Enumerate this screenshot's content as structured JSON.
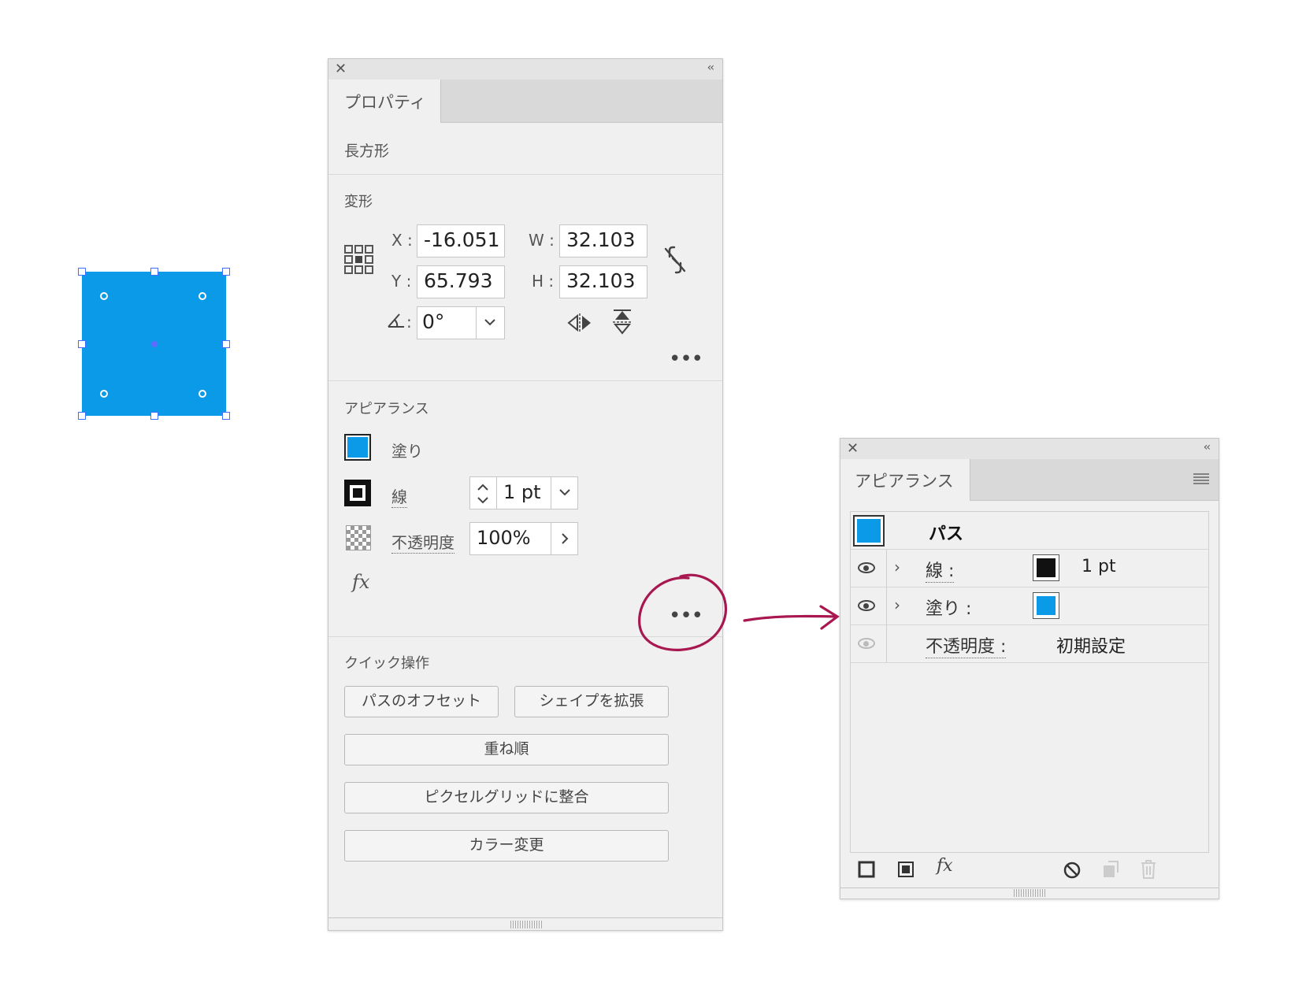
{
  "properties_panel": {
    "tab_label": "プロパティ",
    "object_type": "長方形",
    "transform": {
      "title": "変形",
      "x_label": "X :",
      "x_value": "-16.051",
      "y_label": "Y :",
      "y_value": "65.793",
      "w_label": "W :",
      "w_value": "32.103",
      "h_label": "H :",
      "h_value": "32.103",
      "rotate_label": ":",
      "rotate_value": "0°"
    },
    "appearance": {
      "title": "アピアランス",
      "fill_label": "塗り",
      "stroke_label": "線",
      "stroke_value": "1 pt",
      "opacity_label": "不透明度",
      "opacity_value": "100%",
      "fx_label": "fx"
    },
    "quick_actions": {
      "title": "クイック操作",
      "offset_path": "パスのオフセット",
      "expand_shape": "シェイプを拡張",
      "arrange": "重ね順",
      "align_pixel_grid": "ピクセルグリッドに整合",
      "recolor": "カラー変更"
    },
    "more_dots": "•••"
  },
  "appearance_panel": {
    "tab_label": "アピアランス",
    "path_label": "パス",
    "stroke_label": "線 :",
    "stroke_value": "1 pt",
    "fill_label": "塗り :",
    "opacity_label": "不透明度 :",
    "opacity_value": "初期設定",
    "fx_label": "fx"
  },
  "colors": {
    "fill_blue": "#0b9ae8",
    "selection_blue": "#3f6fff",
    "annotation": "#a8174f"
  }
}
